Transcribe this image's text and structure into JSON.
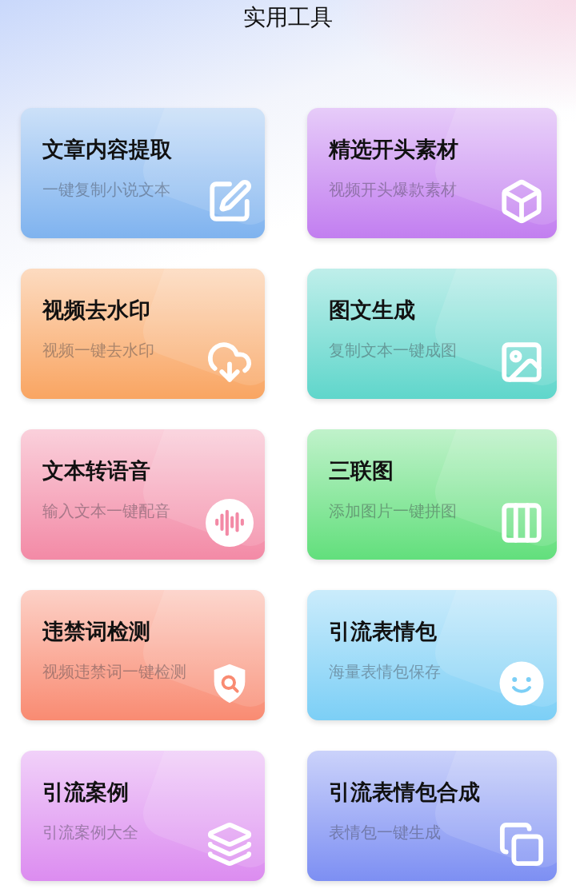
{
  "header": {
    "title": "实用工具"
  },
  "cards": [
    {
      "title": "文章内容提取",
      "subtitle": "一键复制小说文本",
      "kind": "edit",
      "color": "#7fb3ef"
    },
    {
      "title": "精选开头素材",
      "subtitle": "视频开头爆款素材",
      "kind": "box",
      "color": "#c27ef0"
    },
    {
      "title": "视频去水印",
      "subtitle": "视频一键去水印",
      "kind": "download",
      "color": "#f9a562"
    },
    {
      "title": "图文生成",
      "subtitle": "复制文本一键成图",
      "kind": "image",
      "color": "#5fd6cb"
    },
    {
      "title": "文本转语音",
      "subtitle": "输入文本一键配音",
      "kind": "audio",
      "color": "#f38aa6"
    },
    {
      "title": "三联图",
      "subtitle": "添加图片一键拼图",
      "kind": "columns",
      "color": "#62df7c"
    },
    {
      "title": "违禁词检测",
      "subtitle": "视频违禁词一键检测",
      "kind": "shield",
      "color": "#f98b72"
    },
    {
      "title": "引流表情包",
      "subtitle": "海量表情包保存",
      "kind": "smile",
      "color": "#7ccff6"
    },
    {
      "title": "引流案例",
      "subtitle": "引流案例大全",
      "kind": "layers",
      "color": "#dc8cf0"
    },
    {
      "title": "引流表情包合成",
      "subtitle": "表情包一键生成",
      "kind": "copy",
      "color": "#7d8ff3"
    }
  ]
}
